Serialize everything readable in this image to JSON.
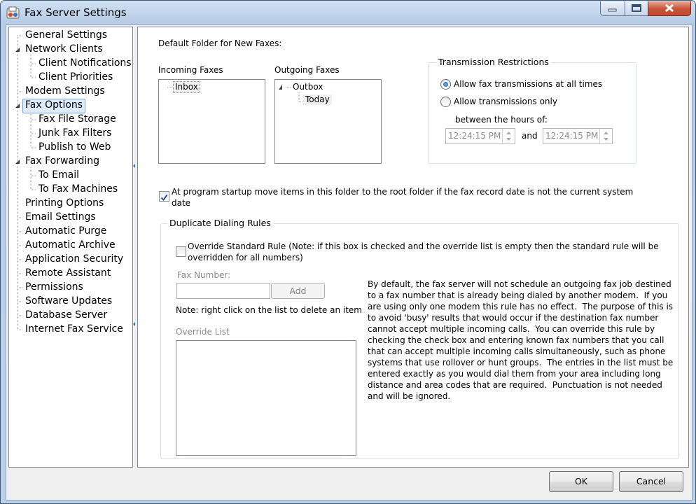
{
  "window": {
    "title": "Fax Server Settings"
  },
  "nav": {
    "items": [
      {
        "label": "General Settings",
        "level": 0,
        "expander": false
      },
      {
        "label": "Network Clients",
        "level": 0,
        "expander": true
      },
      {
        "label": "Client Notifications",
        "level": 1,
        "expander": false
      },
      {
        "label": "Client Priorities",
        "level": 1,
        "expander": false
      },
      {
        "label": "Modem Settings",
        "level": 0,
        "expander": false
      },
      {
        "label": "Fax Options",
        "level": 0,
        "expander": true,
        "selected": true
      },
      {
        "label": "Fax File Storage",
        "level": 1,
        "expander": false
      },
      {
        "label": "Junk Fax Filters",
        "level": 1,
        "expander": false
      },
      {
        "label": "Publish to Web",
        "level": 1,
        "expander": false
      },
      {
        "label": "Fax Forwarding",
        "level": 0,
        "expander": true
      },
      {
        "label": "To Email",
        "level": 1,
        "expander": false
      },
      {
        "label": "To Fax Machines",
        "level": 1,
        "expander": false
      },
      {
        "label": "Printing Options",
        "level": 0,
        "expander": false
      },
      {
        "label": "Email Settings",
        "level": 0,
        "expander": false
      },
      {
        "label": "Automatic Purge",
        "level": 0,
        "expander": false
      },
      {
        "label": "Automatic Archive",
        "level": 0,
        "expander": false
      },
      {
        "label": "Application Security",
        "level": 0,
        "expander": false
      },
      {
        "label": "Remote Assistant",
        "level": 0,
        "expander": false
      },
      {
        "label": "Permissions",
        "level": 0,
        "expander": false
      },
      {
        "label": "Software Updates",
        "level": 0,
        "expander": false
      },
      {
        "label": "Database Server",
        "level": 0,
        "expander": false
      },
      {
        "label": "Internet Fax Service",
        "level": 0,
        "expander": false
      }
    ]
  },
  "folders": {
    "heading": "Default Folder for New Faxes:",
    "incoming_label": "Incoming Faxes",
    "incoming_items": [
      "Inbox"
    ],
    "outgoing_label": "Outgoing Faxes",
    "outgoing_root": "Outbox",
    "outgoing_child": "Today"
  },
  "transmission": {
    "title": "Transmission Restrictions",
    "option_all": "Allow fax transmissions at all times",
    "option_only": "Allow transmissions only",
    "selected": "all",
    "between_label": "between the hours of:",
    "start_time": "12:24:15 PM",
    "and_label": "and",
    "end_time": "12:24:15 PM"
  },
  "startup_move": {
    "checked": true,
    "label_line1": "At program startup move items in this folder to the root folder if the fax record date is not the current system",
    "label_line2": "date"
  },
  "duplicate": {
    "title": "Duplicate Dialing Rules",
    "override_checked": false,
    "override_line1": "Override Standard Rule (Note: if this box is checked and the override list is empty then the standard rule will be",
    "override_line2": "overridden for all numbers)",
    "fax_number_label": "Fax Number:",
    "fax_number_value": "",
    "add_label": "Add",
    "note": "Note: right click on the list to delete an item",
    "override_list_label": "Override List",
    "override_list_items": [],
    "description_lines": [
      "By default, the fax server will not schedule an outgoing fax job destined",
      "to a fax number that is already being dialed by another modem.  If you",
      "are using only one modem this rule has no effect.  The purpose of this is",
      "to avoid 'busy' results that would occur if the destination fax number",
      "cannot accept multiple incoming calls.  You can override this rule by",
      "checking the check box and entering known fax numbers that you call",
      "that can accept multiple incoming calls simultaneously, such as phone",
      "systems that use rollover or hunt groups.  The entries in the list must be",
      "entered exactly as you would dial them from your area including long",
      "distance and area codes that are required.  Punctuation is not needed",
      "and will be ignored."
    ]
  },
  "footer": {
    "ok_label": "OK",
    "cancel_label": "Cancel"
  },
  "colors": {
    "selection_bg": "#ddecfc",
    "selection_border": "#7da2ce",
    "close_button": "#c8523a"
  }
}
